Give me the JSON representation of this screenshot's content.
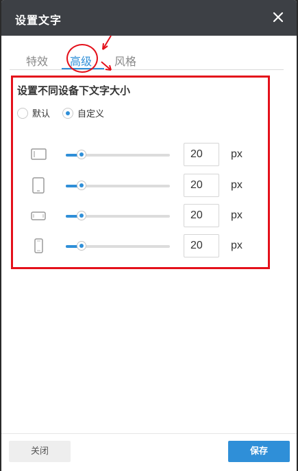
{
  "dialog": {
    "title": "设置文字",
    "close_icon": "close-icon"
  },
  "tabs": [
    {
      "label": "特效",
      "active": false
    },
    {
      "label": "高级",
      "active": true
    },
    {
      "label": "风格",
      "active": false
    }
  ],
  "panel": {
    "title": "设置不同设备下文字大小",
    "radio_options": [
      {
        "label": "默认",
        "checked": false
      },
      {
        "label": "自定义",
        "checked": true
      }
    ],
    "devices": [
      {
        "icon": "desktop-icon",
        "value": "20",
        "unit": "px",
        "slider_percent": 15
      },
      {
        "icon": "tablet-portrait-icon",
        "value": "20",
        "unit": "px",
        "slider_percent": 15
      },
      {
        "icon": "phone-landscape-icon",
        "value": "20",
        "unit": "px",
        "slider_percent": 15
      },
      {
        "icon": "phone-portrait-icon",
        "value": "20",
        "unit": "px",
        "slider_percent": 15
      }
    ]
  },
  "footer": {
    "close_label": "关闭",
    "save_label": "保存"
  },
  "colors": {
    "accent": "#2f8fd8",
    "annotation": "#e4101a",
    "header_bg": "#3d4045"
  }
}
